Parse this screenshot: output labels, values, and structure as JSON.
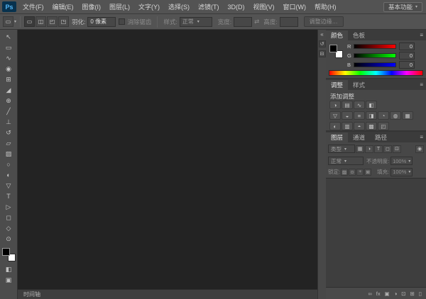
{
  "app": {
    "logo": "Ps",
    "workspace_button": "基本功能"
  },
  "icons": {
    "caret_down": "▾"
  },
  "menu_bar": {
    "items": [
      "文件(F)",
      "编辑(E)",
      "图像(I)",
      "图层(L)",
      "文字(Y)",
      "选择(S)",
      "滤镜(T)",
      "3D(D)",
      "视图(V)",
      "窗口(W)",
      "帮助(H)"
    ]
  },
  "options_bar": {
    "tool_preset_glyph": "▭",
    "selection_modes": [
      {
        "name": "new-selection",
        "glyph": "▭"
      },
      {
        "name": "add-selection",
        "glyph": "◫"
      },
      {
        "name": "subtract-selection",
        "glyph": "◰"
      },
      {
        "name": "intersect-selection",
        "glyph": "◳"
      }
    ],
    "feather_label": "羽化:",
    "feather_value": "0 像素",
    "antialias_label": "消除锯齿",
    "style_label": "样式:",
    "style_value": "正常",
    "width_label": "宽度:",
    "swap_glyph": "⇄",
    "height_label": "高度:",
    "refine_edge_label": "调整边缘…"
  },
  "toolbar": {
    "tools": [
      {
        "name": "move-tool",
        "glyph": "↖"
      },
      {
        "name": "marquee-tool",
        "glyph": "▭"
      },
      {
        "name": "lasso-tool",
        "glyph": "∿"
      },
      {
        "name": "quick-selection-tool",
        "glyph": "◉"
      },
      {
        "name": "crop-tool",
        "glyph": "⊞"
      },
      {
        "name": "eyedropper-tool",
        "glyph": "◢"
      },
      {
        "name": "healing-brush-tool",
        "glyph": "⊕"
      },
      {
        "name": "brush-tool",
        "glyph": "╱"
      },
      {
        "name": "clone-stamp-tool",
        "glyph": "⊥"
      },
      {
        "name": "history-brush-tool",
        "glyph": "↺"
      },
      {
        "name": "eraser-tool",
        "glyph": "▱"
      },
      {
        "name": "gradient-tool",
        "glyph": "▨"
      },
      {
        "name": "blur-tool",
        "glyph": "○"
      },
      {
        "name": "dodge-tool",
        "glyph": "◐"
      },
      {
        "name": "pen-tool",
        "glyph": "▽"
      },
      {
        "name": "type-tool",
        "glyph": "T"
      },
      {
        "name": "path-selection-tool",
        "glyph": "▷"
      },
      {
        "name": "shape-tool",
        "glyph": "◻"
      },
      {
        "name": "hand-tool",
        "glyph": "◇"
      },
      {
        "name": "zoom-tool",
        "glyph": "⊙"
      }
    ],
    "foreground_color": "#000000",
    "background_color": "#ffffff",
    "quick_mask_glyph": "◧",
    "screen_mode_glyph": "▣"
  },
  "dock_strip": {
    "expand_glyph": "«",
    "icons": [
      {
        "name": "history-panel",
        "glyph": "↺"
      },
      {
        "name": "properties-panel",
        "glyph": "⊟"
      }
    ]
  },
  "color_panel": {
    "tabs": [
      "颜色",
      "色板"
    ],
    "menu_glyph": "≡",
    "channels": [
      {
        "label": "R",
        "value": "0",
        "color": "#ff0000"
      },
      {
        "label": "G",
        "value": "0",
        "color": "#00ff00"
      },
      {
        "label": "B",
        "value": "0",
        "color": "#0000ff"
      }
    ]
  },
  "adjustments_panel": {
    "tabs": [
      "调整",
      "样式"
    ],
    "menu_glyph": "≡",
    "title": "添加调整",
    "row1": [
      {
        "name": "brightness-contrast",
        "glyph": "◑"
      },
      {
        "name": "levels",
        "glyph": "▤"
      },
      {
        "name": "curves",
        "glyph": "∿"
      },
      {
        "name": "exposure",
        "glyph": "◧"
      }
    ],
    "row2": [
      {
        "name": "vibrance",
        "glyph": "▽"
      },
      {
        "name": "hue-saturation",
        "glyph": "◒"
      },
      {
        "name": "color-balance",
        "glyph": "≡"
      },
      {
        "name": "black-white",
        "glyph": "◨"
      },
      {
        "name": "photo-filter",
        "glyph": "◔"
      },
      {
        "name": "channel-mixer",
        "glyph": "◍"
      },
      {
        "name": "color-lookup",
        "glyph": "▦"
      }
    ],
    "row3": [
      {
        "name": "invert",
        "glyph": "◐"
      },
      {
        "name": "posterize",
        "glyph": "▥"
      },
      {
        "name": "threshold",
        "glyph": "◓"
      },
      {
        "name": "gradient-map",
        "glyph": "▩"
      },
      {
        "name": "selective-color",
        "glyph": "◰"
      }
    ]
  },
  "layers_panel": {
    "tabs": [
      "图层",
      "通道",
      "路径"
    ],
    "menu_glyph": "≡",
    "filter_label": "类型",
    "filter_icons": [
      {
        "name": "filter-pixel-layers",
        "glyph": "▦"
      },
      {
        "name": "filter-adjustment-layers",
        "glyph": "◑"
      },
      {
        "name": "filter-type-layers",
        "glyph": "T"
      },
      {
        "name": "filter-shape-layers",
        "glyph": "◻"
      },
      {
        "name": "filter-smart-objects",
        "glyph": "⊡"
      }
    ],
    "filter_toggle_glyph": "◉",
    "blend_mode": "正常",
    "opacity_label": "不透明度:",
    "opacity_value": "100%",
    "lock_label": "锁定:",
    "lock_icons": [
      {
        "name": "lock-transparent-pixels",
        "glyph": "▨"
      },
      {
        "name": "lock-image-pixels",
        "glyph": "⊙"
      },
      {
        "name": "lock-position",
        "glyph": "+"
      },
      {
        "name": "lock-all",
        "glyph": "⊠"
      }
    ],
    "fill_label": "填充:",
    "fill_value": "100%",
    "bottom_icons": [
      {
        "name": "link-layers",
        "glyph": "∞"
      },
      {
        "name": "layer-effects",
        "glyph": "fx"
      },
      {
        "name": "add-layer-mask",
        "glyph": "▣"
      },
      {
        "name": "new-adjustment-layer",
        "glyph": "◑"
      },
      {
        "name": "new-group",
        "glyph": "⊡"
      },
      {
        "name": "new-layer",
        "glyph": "⊞"
      },
      {
        "name": "delete-layer",
        "glyph": "▯"
      }
    ]
  },
  "timeline_bar": {
    "label": "时间轴"
  }
}
